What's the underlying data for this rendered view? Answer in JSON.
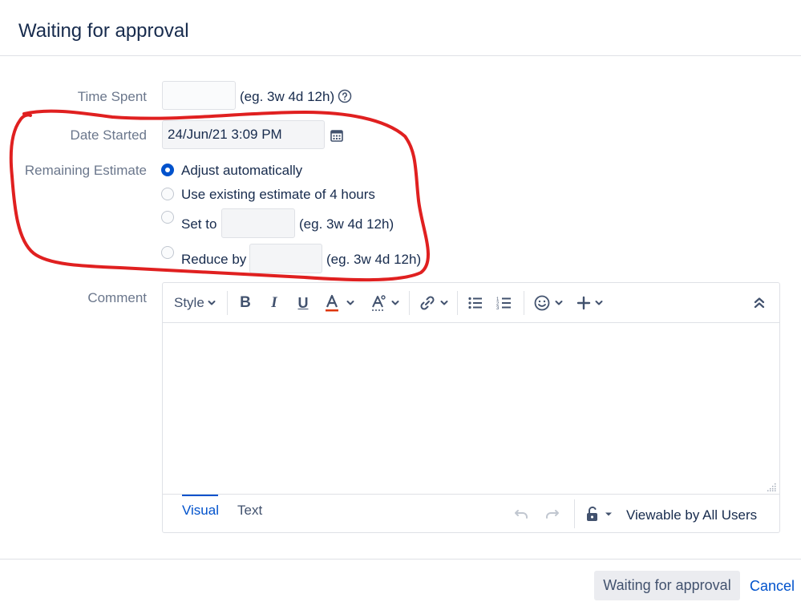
{
  "dialog": {
    "title": "Waiting for approval"
  },
  "form": {
    "time_spent": {
      "label": "Time Spent",
      "value": "",
      "hint": "(eg. 3w 4d 12h)"
    },
    "date_started": {
      "label": "Date Started",
      "value": "24/Jun/21 3:09 PM"
    },
    "remaining_estimate": {
      "label": "Remaining Estimate",
      "options": [
        {
          "label": "Adjust automatically",
          "checked": true
        },
        {
          "label": "Use existing estimate of 4 hours",
          "checked": false
        },
        {
          "label": "Set to",
          "value": "",
          "hint": "(eg. 3w 4d 12h)",
          "checked": false
        },
        {
          "label": "Reduce by",
          "value": "",
          "hint": "(eg. 3w 4d 12h)",
          "checked": false
        }
      ]
    },
    "comment": {
      "label": "Comment"
    }
  },
  "editor": {
    "toolbar": {
      "style_label": "Style",
      "icons": [
        "bold-icon",
        "italic-icon",
        "underline-icon",
        "text-color-icon",
        "text-effects-icon",
        "link-icon",
        "bullet-list-icon",
        "numbered-list-icon",
        "emoji-icon",
        "insert-more-icon",
        "collapse-toolbar-icon"
      ]
    },
    "content": "",
    "tabs": [
      {
        "label": "Visual",
        "active": true
      },
      {
        "label": "Text",
        "active": false
      }
    ],
    "visibility": "Viewable by All Users"
  },
  "footer": {
    "submit_label": "Waiting for approval",
    "cancel_label": "Cancel"
  },
  "colors": {
    "accent": "#0052cc",
    "annotation": "#e02020"
  }
}
